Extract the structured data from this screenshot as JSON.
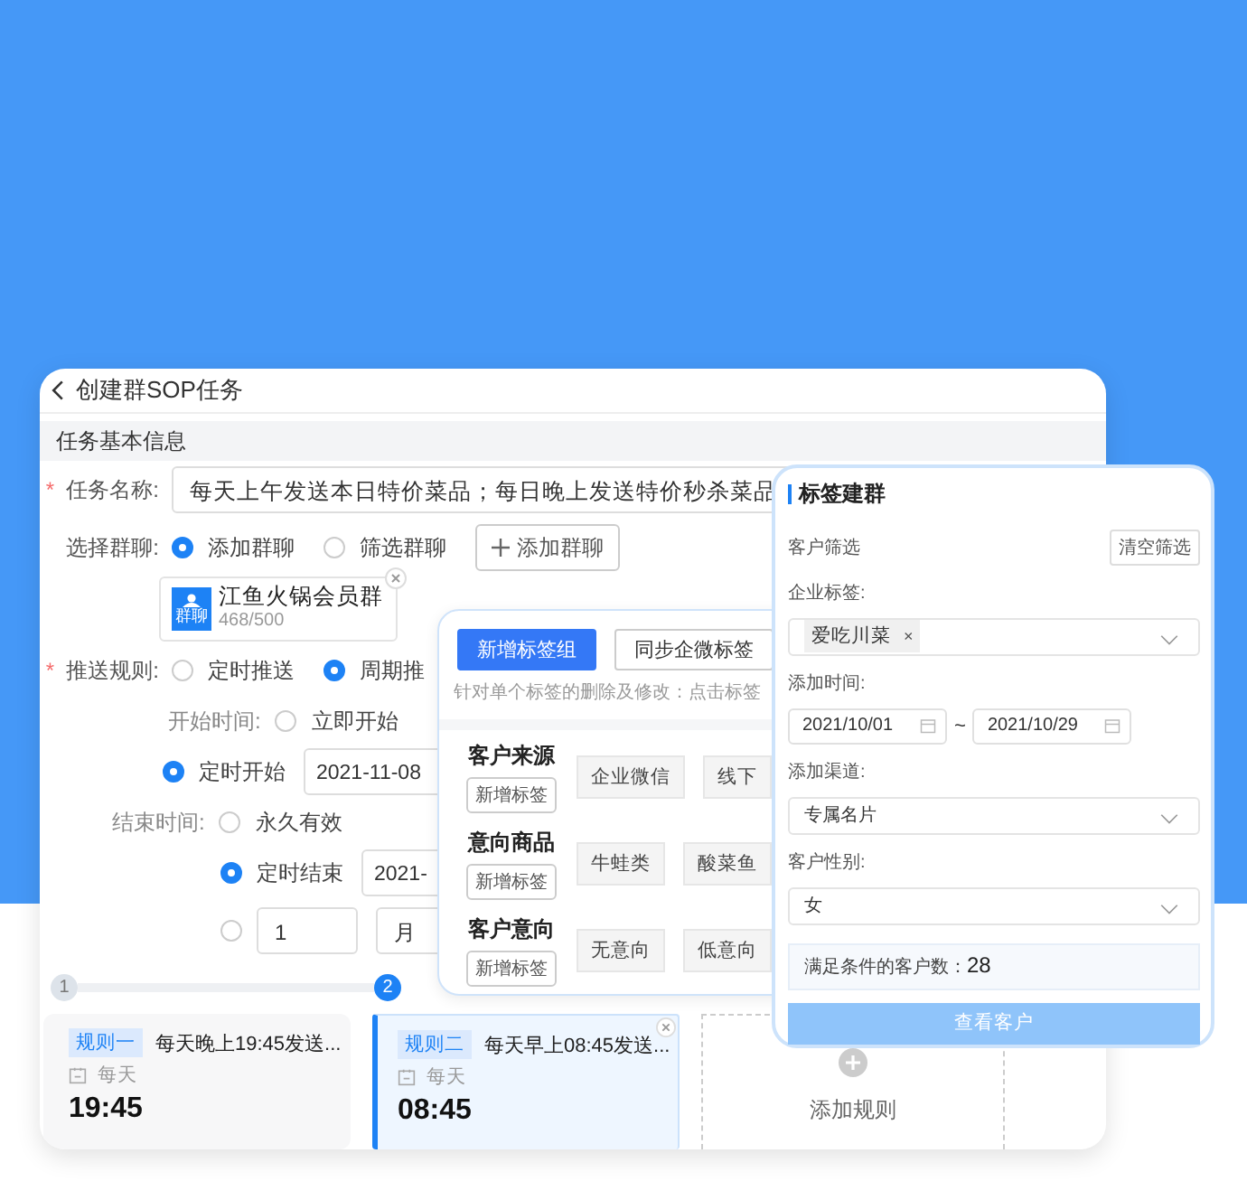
{
  "task_window": {
    "title": "创建群SOP任务",
    "section": "任务基本信息",
    "task_name": {
      "label": "任务名称:",
      "required_mark": "*",
      "value": "每天上午发送本日特价菜品；每日晚上发送特价秒杀菜品"
    },
    "group_select": {
      "label": "选择群聊:",
      "options": [
        {
          "label": "添加群聊",
          "selected": true
        },
        {
          "label": "筛选群聊",
          "selected": false
        }
      ],
      "add_button": "添加群聊"
    },
    "group_card": {
      "name": "江鱼火锅会员群",
      "avatar_label": "群聊",
      "count": "468/500"
    },
    "push_rule": {
      "label": "推送规则:",
      "required_mark": "*",
      "options": [
        {
          "label": "定时推送",
          "selected": false
        },
        {
          "label": "周期推",
          "selected": true
        }
      ]
    },
    "start_time": {
      "label": "开始时间:",
      "options": [
        {
          "label": "立即开始",
          "selected": false
        },
        {
          "label": "定时开始",
          "selected": true,
          "value": "2021-11-08"
        }
      ]
    },
    "end_time": {
      "label": "结束时间:",
      "options": [
        {
          "label": "永久有效",
          "selected": false
        },
        {
          "label": "定时结束",
          "selected": true,
          "value": "2021-"
        },
        {
          "selected": false,
          "value": "1",
          "unit": "月"
        }
      ]
    },
    "steps": [
      {
        "label": "1",
        "selected": false
      },
      {
        "label": "2",
        "selected": true
      }
    ],
    "rules": [
      {
        "tag": "规则一",
        "text": "每天晚上19:45发送...",
        "repeat": "每天",
        "time": "19:45",
        "selected": false
      },
      {
        "tag": "规则二",
        "text": "每天早上08:45发送...",
        "repeat": "每天",
        "time": "08:45",
        "selected": true
      }
    ],
    "add_rule": "添加规则"
  },
  "tag_popup": {
    "buttons": [
      {
        "label": "新增标签组",
        "kind": "primary"
      },
      {
        "label": "同步企微标签",
        "kind": "default"
      }
    ],
    "hint": "针对单个标签的删除及修改：点击标签",
    "groups": [
      {
        "name": "客户来源",
        "add": "新增标签",
        "tags": [
          "企业微信",
          "线下"
        ]
      },
      {
        "name": "意向商品",
        "add": "新增标签",
        "tags": [
          "牛蛙类",
          "酸菜鱼"
        ]
      },
      {
        "name": "客户意向",
        "add": "新增标签",
        "tags": [
          "无意向",
          "低意向"
        ]
      }
    ]
  },
  "tag_group_panel": {
    "title": "标签建群",
    "filter_label": "客户筛选",
    "clear_button": "清空筛选",
    "fields": [
      {
        "kind": "chips",
        "label": "企业标签:",
        "chips": [
          {
            "label": "爱吃川菜",
            "remove": "×"
          }
        ]
      },
      {
        "kind": "daterange",
        "label": "添加时间:",
        "start": "2021/10/01",
        "end": "2021/10/29",
        "separator": "~"
      },
      {
        "kind": "select",
        "label": "添加渠道:",
        "value": "专属名片"
      },
      {
        "kind": "select",
        "label": "客户性别:",
        "value": "女"
      }
    ],
    "result_label": "满足条件的客户数：",
    "result_value": "28",
    "submit": {
      "label": "查看客户",
      "disabled": true
    }
  }
}
